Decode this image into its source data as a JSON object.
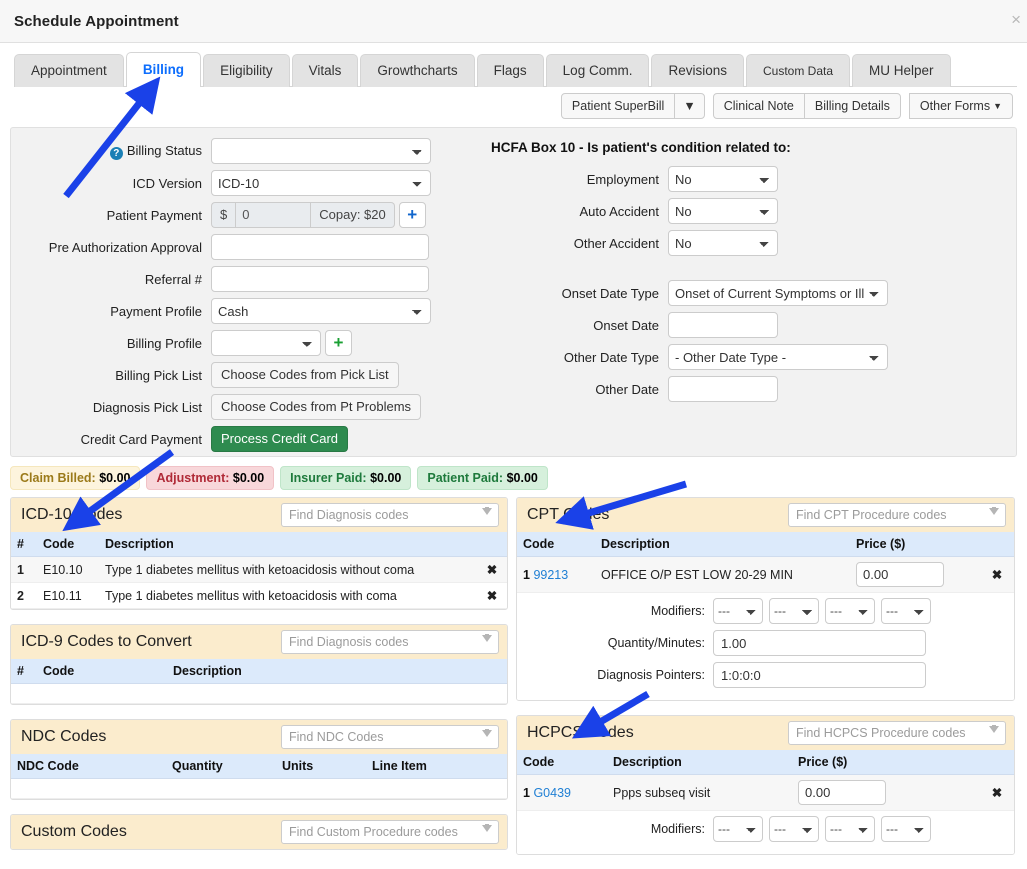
{
  "window": {
    "title": "Schedule Appointment",
    "close_icon": "×"
  },
  "tabs": [
    {
      "label": "Appointment",
      "active": false
    },
    {
      "label": "Billing",
      "active": true
    },
    {
      "label": "Eligibility",
      "active": false
    },
    {
      "label": "Vitals",
      "active": false
    },
    {
      "label": "Growthcharts",
      "active": false
    },
    {
      "label": "Flags",
      "active": false
    },
    {
      "label": "Log Comm.",
      "active": false
    },
    {
      "label": "Revisions",
      "active": false
    },
    {
      "label": "Custom Data",
      "active": false
    },
    {
      "label": "MU Helper",
      "active": false
    }
  ],
  "toolbar": {
    "superbill": "Patient SuperBill",
    "superbill_caret": "▼",
    "clinical_note": "Clinical Note",
    "billing_details": "Billing Details",
    "other_forms": "Other Forms",
    "other_forms_caret": "▼"
  },
  "billing_form": {
    "billing_status": {
      "label": "Billing Status",
      "value": "",
      "help_icon": "?"
    },
    "icd_version": {
      "label": "ICD Version",
      "value": "ICD-10"
    },
    "patient_payment": {
      "label": "Patient Payment",
      "currency": "$",
      "value": "0",
      "copay": "Copay: $20",
      "add": "+"
    },
    "pre_auth": {
      "label": "Pre Authorization Approval",
      "value": ""
    },
    "referral": {
      "label": "Referral #",
      "value": ""
    },
    "payment_profile": {
      "label": "Payment Profile",
      "value": "Cash"
    },
    "billing_profile": {
      "label": "Billing Profile",
      "value": "",
      "add": "+"
    },
    "billing_pick_list": {
      "label": "Billing Pick List",
      "button": "Choose Codes from Pick List"
    },
    "diagnosis_pick_list": {
      "label": "Diagnosis Pick List",
      "button": "Choose Codes from Pt Problems"
    },
    "credit_card": {
      "label": "Credit Card Payment",
      "button": "Process Credit Card"
    }
  },
  "hcfa": {
    "heading": "HCFA Box 10 - Is patient's condition related to:",
    "employment": {
      "label": "Employment",
      "value": "No"
    },
    "auto_accident": {
      "label": "Auto Accident",
      "value": "No"
    },
    "other_accident": {
      "label": "Other Accident",
      "value": "No"
    },
    "onset_date_type": {
      "label": "Onset Date Type",
      "value": "Onset of Current Symptoms or Illness"
    },
    "onset_date": {
      "label": "Onset Date",
      "value": ""
    },
    "other_date_type": {
      "label": "Other Date Type",
      "value": "- Other Date Type -"
    },
    "other_date": {
      "label": "Other Date",
      "value": ""
    }
  },
  "badges": [
    {
      "label": "Claim Billed:",
      "amount": "$0.00",
      "style": "billed"
    },
    {
      "label": "Adjustment:",
      "amount": "$0.00",
      "style": "adjust"
    },
    {
      "label": "Insurer Paid:",
      "amount": "$0.00",
      "style": "insurer"
    },
    {
      "label": "Patient Paid:",
      "amount": "$0.00",
      "style": "patient"
    }
  ],
  "icd10_panel": {
    "title": "ICD-10 Codes",
    "search_placeholder": "Find Diagnosis codes",
    "columns": [
      "#",
      "Code",
      "Description"
    ],
    "rows": [
      {
        "num": "1",
        "code": "E10.10",
        "description": "Type 1 diabetes mellitus with ketoacidosis without coma",
        "delete": "✖"
      },
      {
        "num": "2",
        "code": "E10.11",
        "description": "Type 1 diabetes mellitus with ketoacidosis with coma",
        "delete": "✖"
      }
    ]
  },
  "icd9_panel": {
    "title": "ICD-9 Codes to Convert",
    "search_placeholder": "Find Diagnosis codes",
    "columns": [
      "#",
      "Code",
      "Description"
    ],
    "rows": []
  },
  "ndc_panel": {
    "title": "NDC Codes",
    "search_placeholder": "Find NDC Codes",
    "columns": [
      "NDC Code",
      "Quantity",
      "Units",
      "Line Item"
    ],
    "rows": []
  },
  "custom_panel": {
    "title": "Custom Codes",
    "search_placeholder": "Find Custom Procedure codes"
  },
  "cpt_panel": {
    "title": "CPT Codes",
    "search_placeholder": "Find CPT Procedure codes",
    "columns": [
      "Code",
      "Description",
      "Price ($)"
    ],
    "rows": [
      {
        "num": "1",
        "code": "99213",
        "description": "OFFICE O/P EST LOW 20-29 MIN",
        "price": "0.00",
        "delete": "✖"
      }
    ],
    "detail": {
      "modifiers_label": "Modifiers:",
      "modifier_values": [
        "---",
        "---",
        "---",
        "---"
      ],
      "quantity_label": "Quantity/Minutes:",
      "quantity_value": "1.00",
      "pointers_label": "Diagnosis Pointers:",
      "pointers_value": "1:0:0:0"
    }
  },
  "hcpcs_panel": {
    "title": "HCPCS Codes",
    "search_placeholder": "Find HCPCS Procedure codes",
    "columns": [
      "Code",
      "Description",
      "Price ($)"
    ],
    "rows": [
      {
        "num": "1",
        "code": "G0439",
        "description": "Ppps subseq visit",
        "price": "0.00",
        "delete": "✖"
      }
    ],
    "detail": {
      "modifiers_label": "Modifiers:",
      "modifier_values": [
        "---",
        "---",
        "---",
        "---"
      ]
    }
  },
  "annotations": {
    "arrow_color": "#1a41e8",
    "arrows": [
      {
        "name": "arrow-to-billing-tab"
      },
      {
        "name": "arrow-to-icd10-panel"
      },
      {
        "name": "arrow-to-cpt-panel"
      },
      {
        "name": "arrow-to-hcpcs-panel"
      }
    ]
  }
}
